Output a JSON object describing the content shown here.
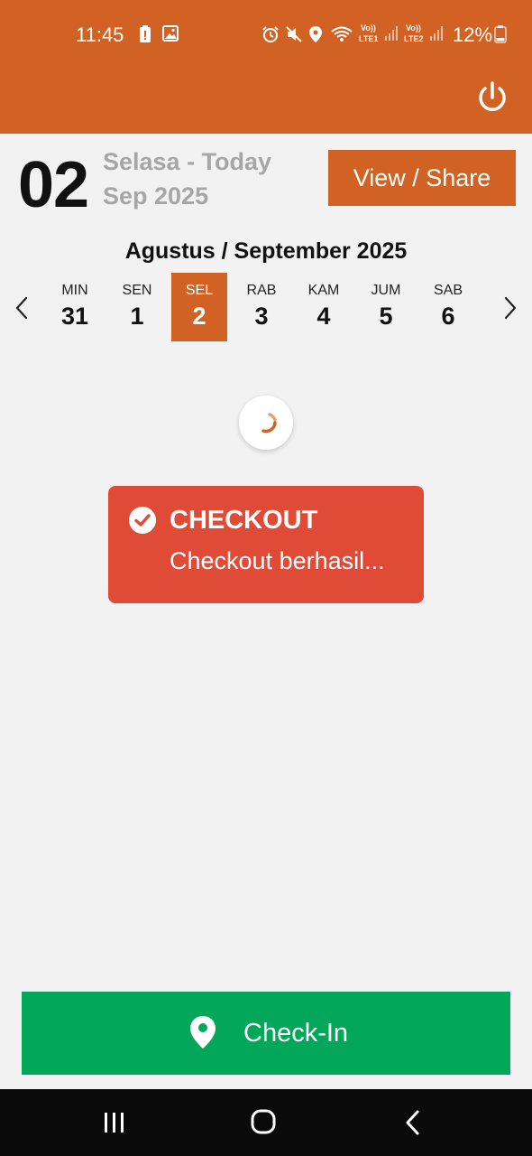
{
  "status_bar": {
    "time": "11:45",
    "battery": "12%",
    "lte1": "LTE1",
    "lte2": "LTE2",
    "volte": "Vo))"
  },
  "header": {
    "power_icon": "power-icon",
    "color": "#d26223"
  },
  "date_summary": {
    "day_number": "02",
    "day_label": "Selasa - Today",
    "month_year": "Sep 2025",
    "view_share_label": "View / Share"
  },
  "calendar": {
    "title": "Agustus / September 2025",
    "days": [
      {
        "name": "MIN",
        "number": "31"
      },
      {
        "name": "SEN",
        "number": "1"
      },
      {
        "name": "SEL",
        "number": "2",
        "selected": true
      },
      {
        "name": "RAB",
        "number": "3"
      },
      {
        "name": "KAM",
        "number": "4"
      },
      {
        "name": "JUM",
        "number": "5"
      },
      {
        "name": "SAB",
        "number": "6"
      }
    ]
  },
  "toast": {
    "title": "CHECKOUT",
    "message": "Checkout berhasil...",
    "color": "#e04b37"
  },
  "checkin_button": {
    "label": "Check-In",
    "color": "#02a75a",
    "icon": "location-pin-icon"
  },
  "colors": {
    "accent": "#d26223",
    "background": "#f2f2f2"
  }
}
